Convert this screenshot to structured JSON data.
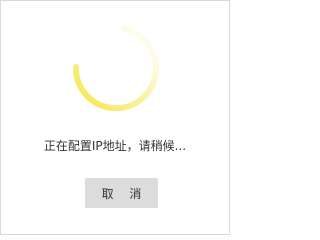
{
  "dialog": {
    "message": "正在配置IP地址，请稍候...",
    "cancel_label": "取 消"
  },
  "spinner": {
    "icon": "loading-spinner-icon"
  },
  "colors": {
    "spinner_accent": "#f5e642",
    "button_bg": "#dcdcdc",
    "text": "#333333",
    "border": "#d9d9d9"
  }
}
